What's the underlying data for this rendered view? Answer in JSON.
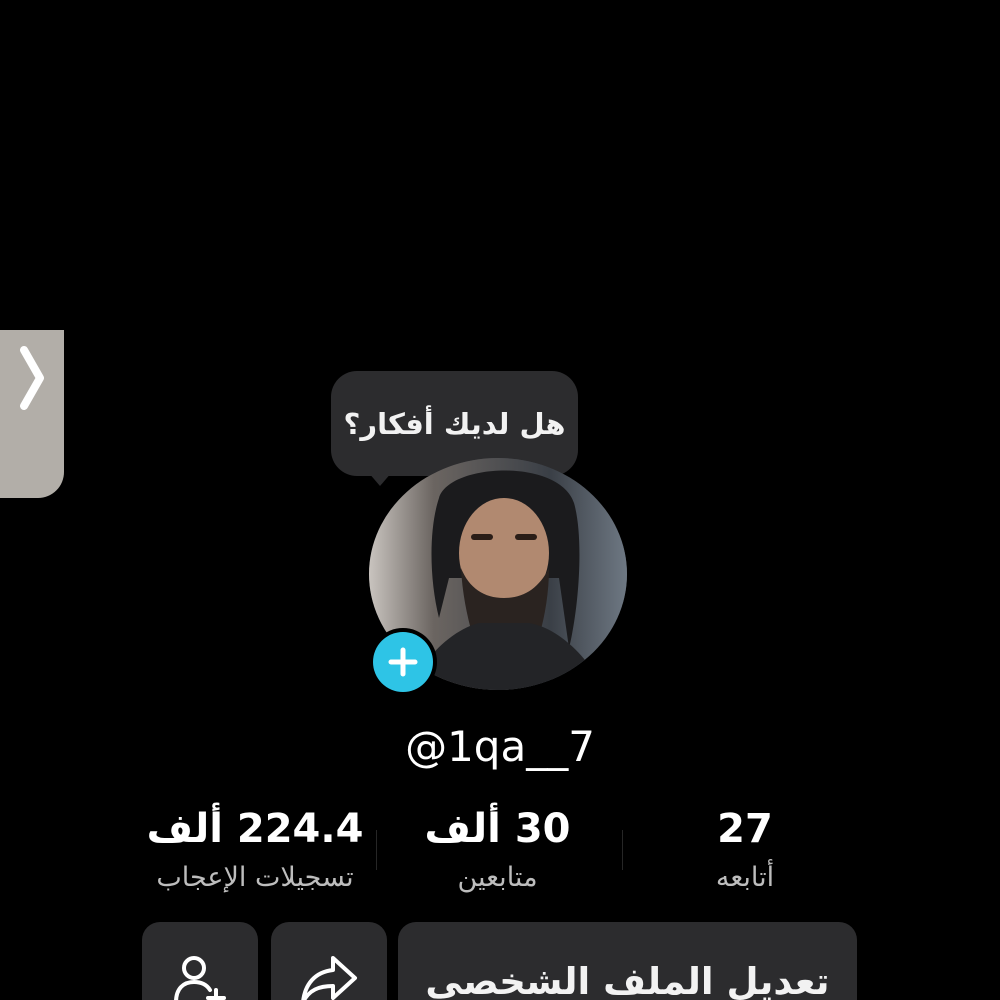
{
  "side_tab": {
    "icon": "chevron-right-icon",
    "color": "#b2aea8"
  },
  "bubble": {
    "text": "هل لديك أفكار؟"
  },
  "avatar": {
    "icon": "profile-photo",
    "add_icon": "plus-icon",
    "add_color": "#2ec4e6"
  },
  "profile": {
    "username": "@1qa__7"
  },
  "stats": {
    "likes": {
      "value": "224.4 ألف",
      "label": "تسجيلات الإعجاب"
    },
    "followers": {
      "value": "30 ألف",
      "label": "متابعين"
    },
    "following": {
      "value": "27",
      "label": "أتابعه"
    }
  },
  "actions": {
    "add_friend_icon": "add-friend-icon",
    "share_icon": "share-icon",
    "edit_label": "تعديل الملف الشخصي"
  }
}
